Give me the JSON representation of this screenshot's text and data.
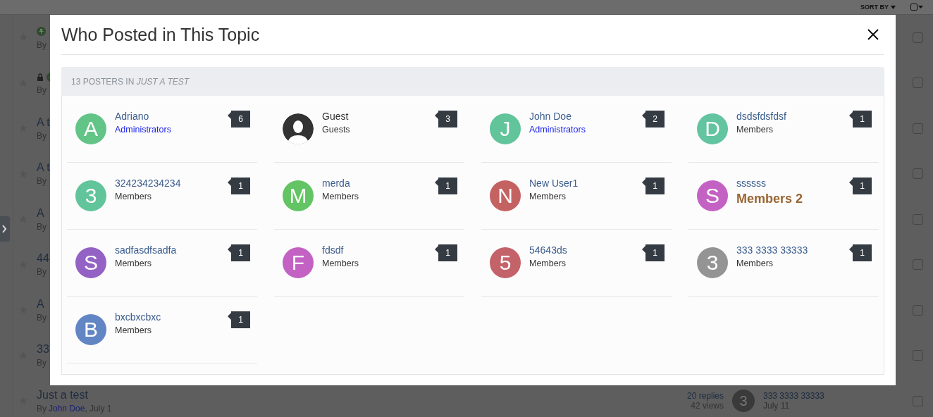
{
  "page": {
    "sort_label": "SORT BY",
    "rows": [
      {
        "icons": [
          {
            "kind": "pin"
          }
        ],
        "title": "",
        "by": "By",
        "checked": false
      },
      {
        "icons": [
          {
            "kind": "lock"
          },
          {
            "kind": "pin"
          }
        ],
        "title": "",
        "by": "By",
        "checked": false
      },
      {
        "icons": [],
        "title": "A t",
        "by": "By",
        "checked": false
      },
      {
        "icons": [],
        "title": "A t",
        "by": "By",
        "checked": false
      },
      {
        "icons": [],
        "title": "A",
        "by": "By",
        "checked": false
      },
      {
        "icons": [],
        "title": "44",
        "by": "By",
        "checked": false
      },
      {
        "icons": [],
        "title": "A",
        "by": "By",
        "checked": false
      },
      {
        "icons": [],
        "title": "33",
        "by": "By",
        "checked": false
      }
    ],
    "last_row": {
      "title": "Just a test",
      "by": "By",
      "author": "John Doe",
      "date": ", July 1",
      "replies": "20 replies",
      "views": "42 views",
      "avatar_letter": "3",
      "last_poster": "333 3333 33333",
      "last_date": "July 11",
      "checked": false
    }
  },
  "modal": {
    "title": "Who Posted in This Topic",
    "caption": "13 POSTERS IN *JUST A TEST*",
    "posters": [
      {
        "name": "Adriano",
        "linked": true,
        "group": {
          "text": "Administrators",
          "kind": "admin"
        },
        "avatar": {
          "kind": "letter",
          "letter": "A",
          "color": "#62c486"
        },
        "count": "6"
      },
      {
        "name": "Guest",
        "linked": false,
        "group": {
          "text": "Guests",
          "kind": "plain"
        },
        "avatar": {
          "kind": "silhouette"
        },
        "count": "3"
      },
      {
        "name": "John Doe",
        "linked": true,
        "group": {
          "text": "Administrators",
          "kind": "admin"
        },
        "avatar": {
          "kind": "letter",
          "letter": "J",
          "color": "#62c49a"
        },
        "count": "2"
      },
      {
        "name": "dsdsfdsfdsf",
        "linked": true,
        "group": {
          "text": "Members",
          "kind": "plain"
        },
        "avatar": {
          "kind": "letter",
          "letter": "D",
          "color": "#62c4a0"
        },
        "count": "1"
      },
      {
        "name": "324234234234",
        "linked": true,
        "group": {
          "text": "Members",
          "kind": "plain"
        },
        "avatar": {
          "kind": "letter",
          "letter": "3",
          "color": "#62c49a"
        },
        "count": "1"
      },
      {
        "name": "merda",
        "linked": true,
        "group": {
          "text": "Members",
          "kind": "plain"
        },
        "avatar": {
          "kind": "letter",
          "letter": "M",
          "color": "#62c462"
        },
        "count": "1"
      },
      {
        "name": "New User1",
        "linked": true,
        "group": {
          "text": "Members",
          "kind": "plain"
        },
        "avatar": {
          "kind": "letter",
          "letter": "N",
          "color": "#c46262"
        },
        "count": "1"
      },
      {
        "name": "ssssss",
        "linked": true,
        "group": {
          "text": "Members 2",
          "kind": "highlight"
        },
        "avatar": {
          "kind": "letter",
          "letter": "S",
          "color": "#c462c4"
        },
        "count": "1"
      },
      {
        "name": "sadfasdfsadfa",
        "linked": true,
        "group": {
          "text": "Members",
          "kind": "plain"
        },
        "avatar": {
          "kind": "letter",
          "letter": "S",
          "color": "#9462c4"
        },
        "count": "1"
      },
      {
        "name": "fdsdf",
        "linked": true,
        "group": {
          "text": "Members",
          "kind": "plain"
        },
        "avatar": {
          "kind": "letter",
          "letter": "F",
          "color": "#c462c4"
        },
        "count": "1"
      },
      {
        "name": "54643ds",
        "linked": true,
        "group": {
          "text": "Members",
          "kind": "plain"
        },
        "avatar": {
          "kind": "letter",
          "letter": "5",
          "color": "#c4626a"
        },
        "count": "1"
      },
      {
        "name": "333 3333 33333",
        "linked": true,
        "group": {
          "text": "Members",
          "kind": "plain"
        },
        "avatar": {
          "kind": "letter",
          "letter": "3",
          "color": "#949494"
        },
        "count": "1"
      },
      {
        "name": "bxcbxcbxc",
        "linked": true,
        "group": {
          "text": "Members",
          "kind": "plain"
        },
        "avatar": {
          "kind": "letter",
          "letter": "B",
          "color": "#6285c4"
        },
        "count": "1"
      }
    ]
  }
}
